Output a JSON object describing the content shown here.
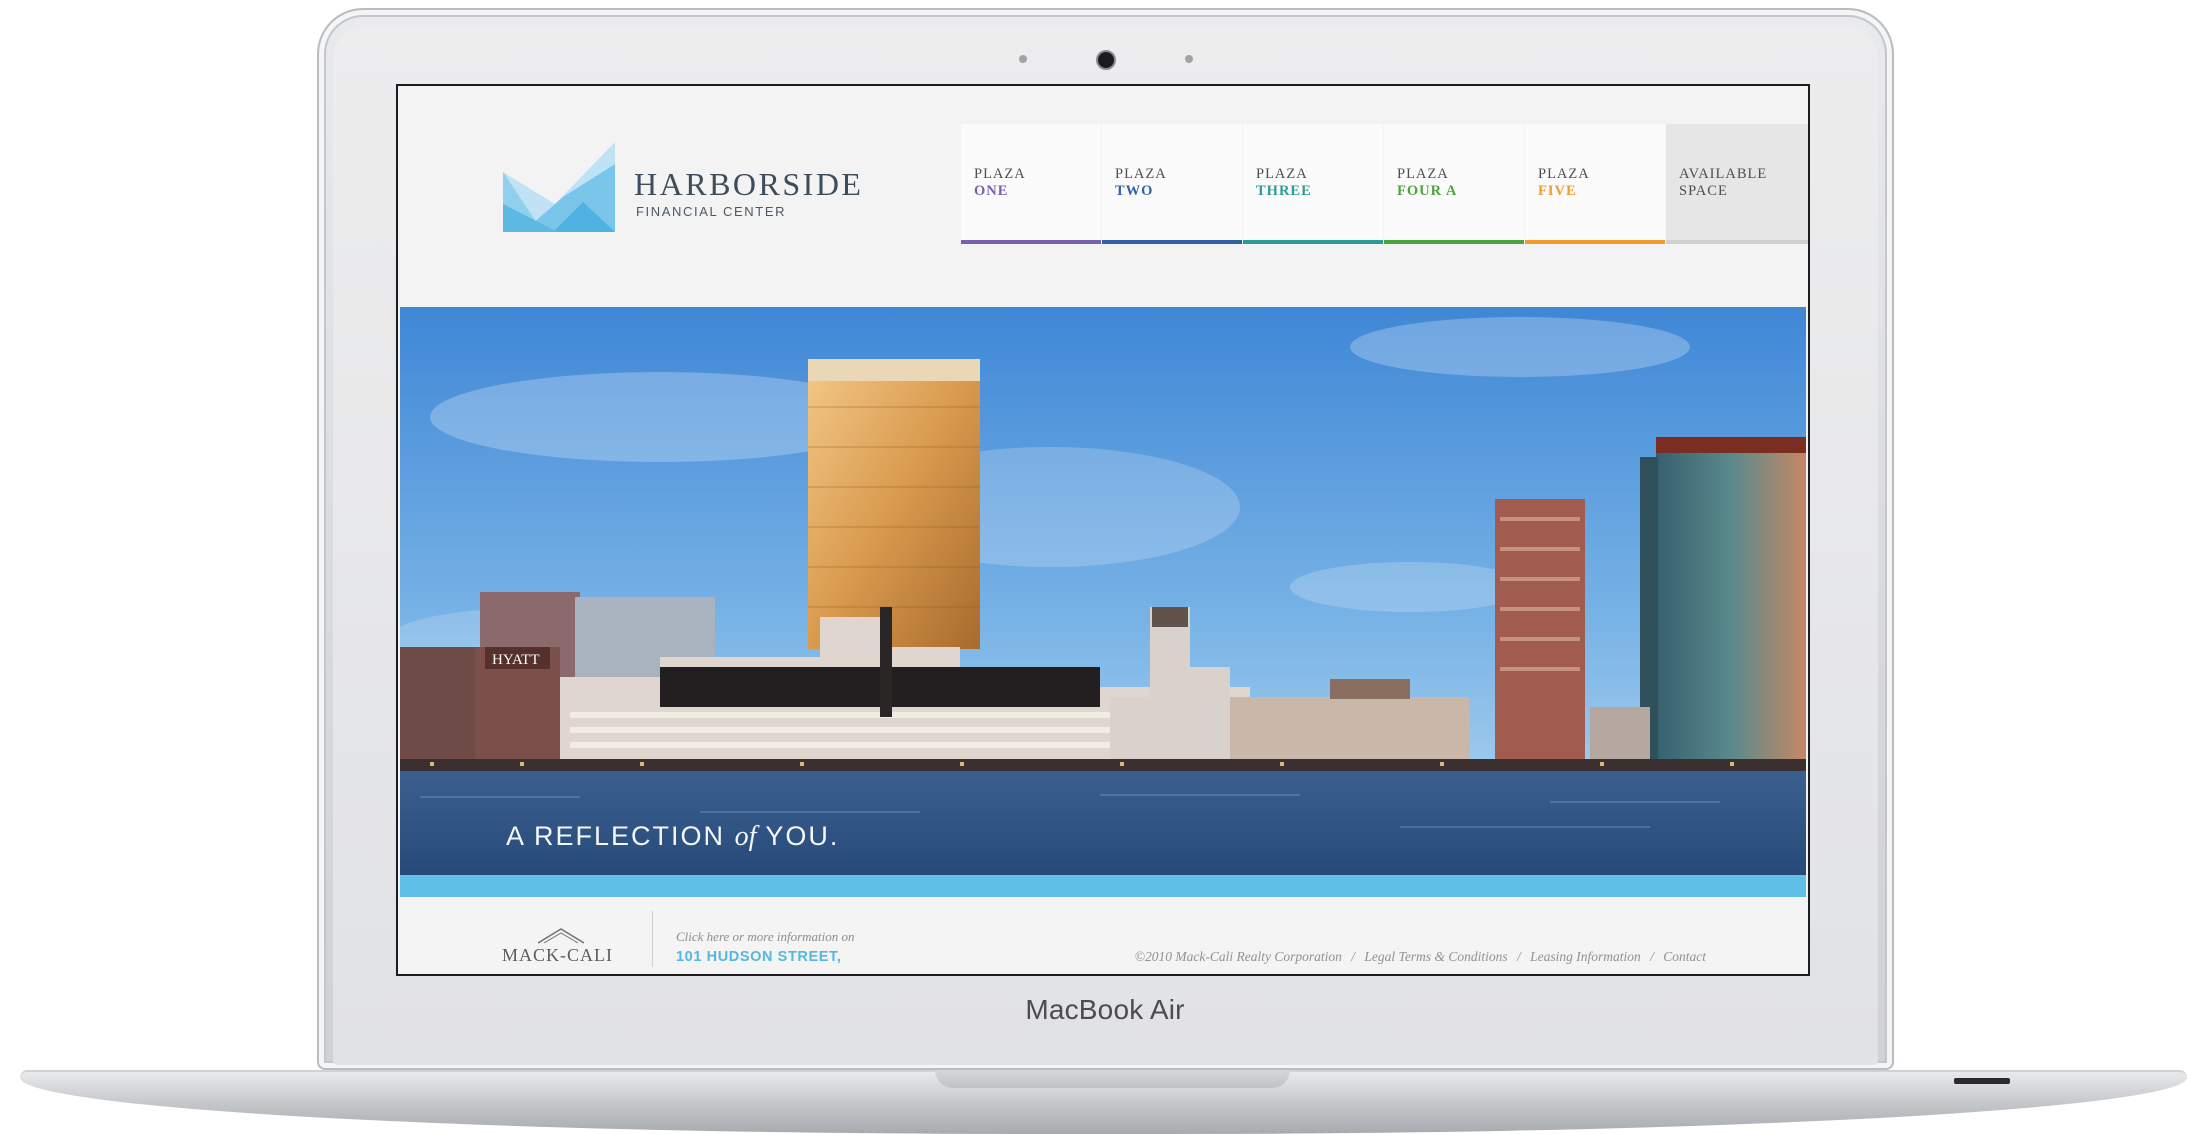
{
  "device": {
    "label": "MacBook Air"
  },
  "site": {
    "logo": {
      "title": "HARBORSIDE",
      "subtitle": "FINANCIAL CENTER"
    },
    "nav": [
      {
        "line1": "PLAZA",
        "line2": "ONE",
        "color": "#7a5fb0"
      },
      {
        "line1": "PLAZA",
        "line2": "TWO",
        "color": "#2f62a8"
      },
      {
        "line1": "PLAZA",
        "line2": "THREE",
        "color": "#2a9c97"
      },
      {
        "line1": "PLAZA",
        "line2": "FOUR A",
        "color": "#4aa63b"
      },
      {
        "line1": "PLAZA",
        "line2": "FIVE",
        "color": "#f39a2f"
      },
      {
        "line1": "AVAILABLE",
        "line2": "SPACE",
        "color": "#4a4f55"
      }
    ],
    "hero": {
      "tag_pre": "A REFLECTION",
      "tag_of": "of",
      "tag_post": "YOU."
    },
    "footer": {
      "brand": "MACK-CALI",
      "hint": "Click here or more information on",
      "link": "101 HUDSON STREET,",
      "copyright": "©2010 Mack-Cali Realty Corporation",
      "legal": "Legal Terms & Conditions",
      "leasing": "Leasing Information",
      "contact": "Contact",
      "separator": "/"
    },
    "colors": {
      "accent_blue": "#60bfe7",
      "logo_blue": "#5bb8e6",
      "text_dark": "#3e4d5c"
    }
  }
}
